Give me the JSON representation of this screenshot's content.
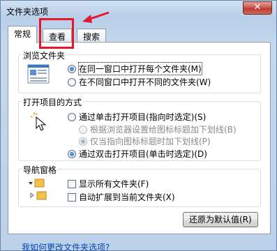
{
  "window": {
    "title": "文件夹选项",
    "close_label": "✕"
  },
  "tabs": [
    {
      "label": "常规",
      "active": true
    },
    {
      "label": "查看",
      "active": false
    },
    {
      "label": "搜索",
      "active": false
    }
  ],
  "browse": {
    "title": "浏览文件夹",
    "options": [
      {
        "label": "在同一窗口中打开每个文件夹(M)",
        "checked": true
      },
      {
        "label": "在不同窗口中打开不同的文件夹(W)",
        "checked": false
      }
    ]
  },
  "open": {
    "title": "打开项目的方式",
    "options": [
      {
        "label": "通过单击打开项目(指向时选定)(S)",
        "checked": false,
        "disabled": false
      },
      {
        "label": "根据浏览器设置给图标标题加下划线(B)",
        "checked": false,
        "disabled": true
      },
      {
        "label": "仅当指向图标标题时加下划线(P)",
        "checked": true,
        "disabled": true
      },
      {
        "label": "通过双击打开项目(单击时选定)(D)",
        "checked": true,
        "disabled": false
      }
    ]
  },
  "nav": {
    "title": "导航窗格",
    "options": [
      {
        "label": "显示所有文件夹(F)",
        "checked": false
      },
      {
        "label": "自动扩展到当前文件夹(X)",
        "checked": false
      }
    ]
  },
  "restore_button": "还原为默认值(R)",
  "help_link": "我如何更改文件夹选项?",
  "colors": {
    "annotation": "#e4172b",
    "link": "#0645ad"
  }
}
